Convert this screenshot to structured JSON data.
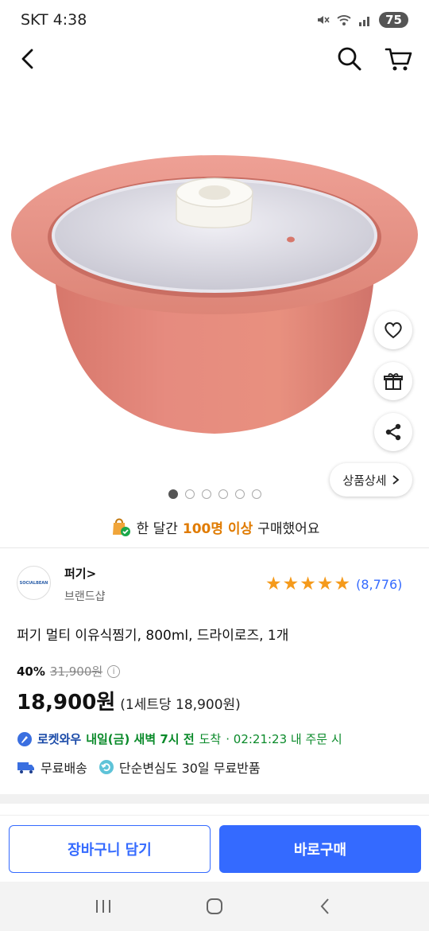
{
  "status": {
    "carrier_time": "SKT 4:38",
    "battery": "75"
  },
  "colors": {
    "accent": "#346aff",
    "rating_star": "#f59a1b",
    "highlight": "#e07b00",
    "delivery_green": "#0a8a2a"
  },
  "icons": {
    "back": "back-arrow-icon",
    "search": "search-icon",
    "cart": "cart-icon",
    "wishlist": "heart-icon",
    "gift": "gift-icon",
    "share": "share-icon"
  },
  "gallery": {
    "detail_label": "상품상세",
    "image_count": 6,
    "active_index": 0
  },
  "social_proof": {
    "prefix": "한 달간",
    "highlight": "100명 이상",
    "suffix": "구매했어요"
  },
  "brand": {
    "logo_text": "SOCIALBEAN",
    "name": "퍼기>",
    "shop_label": "브랜드샵"
  },
  "rating": {
    "stars": 5,
    "review_count": "(8,776)"
  },
  "product": {
    "title": "퍼기 멀티 이유식찜기, 800ml, 드라이로즈, 1개",
    "discount": "40%",
    "original_price": "31,900원",
    "price": "18,900원",
    "unit_price": "(1세트당 18,900원)"
  },
  "delivery": {
    "rocket_label": "로켓와우",
    "arrival": "내일(금) 새벽 7시 전",
    "arrival_suffix": "도착",
    "countdown": "· 02:21:23 내 주문 시",
    "free_shipping": "무료배송",
    "free_return": "단순변심도 30일 무료반품"
  },
  "actions": {
    "add_to_cart": "장바구니 담기",
    "buy_now": "바로구매"
  }
}
